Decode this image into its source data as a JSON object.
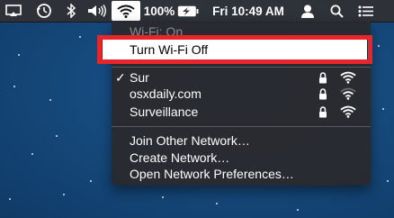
{
  "menubar": {
    "battery_percent": "100%",
    "clock": "Fri 10:49 AM",
    "icons": [
      "airplay-icon",
      "time-machine-icon",
      "bluetooth-icon",
      "volume-icon",
      "wifi-icon",
      "battery-charging-icon",
      "user-icon",
      "spotlight-icon",
      "notification-center-icon"
    ]
  },
  "wifi_menu": {
    "status": "Wi-Fi: On",
    "toggle_label": "Turn Wi-Fi Off",
    "networks": [
      {
        "name": "Sur",
        "connected": true,
        "locked": true
      },
      {
        "name": "osxdaily.com",
        "connected": false,
        "locked": true
      },
      {
        "name": "Surveillance",
        "connected": false,
        "locked": true
      }
    ],
    "actions": [
      "Join Other Network…",
      "Create Network…",
      "Open Network Preferences…"
    ]
  },
  "colors": {
    "highlight_border": "#e8252a",
    "menubar_bg": "#303034",
    "menu_bg": "#2a2a2e"
  }
}
